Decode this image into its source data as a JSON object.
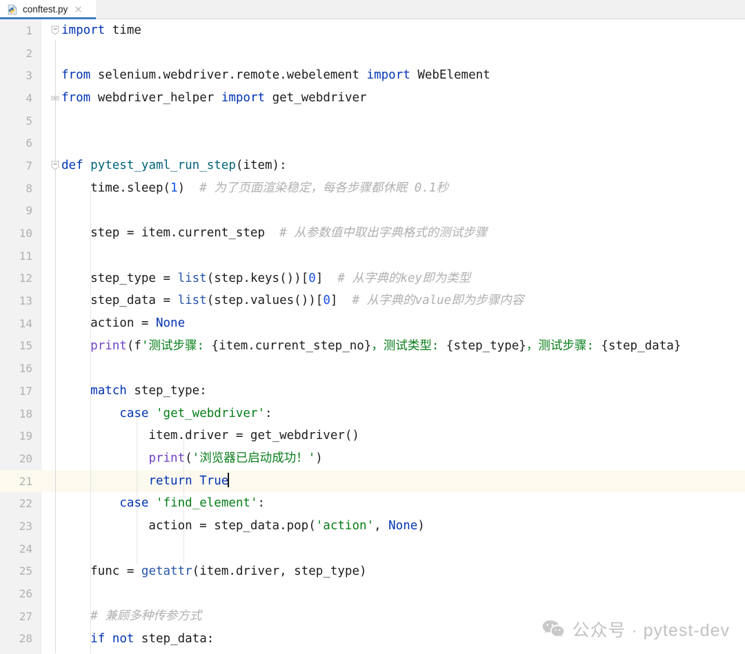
{
  "window": {
    "tab": {
      "label": "conftest.py",
      "icon": "python-file-icon",
      "close_icon": "close-icon",
      "active": true,
      "accent_color": "#3c7bc4"
    }
  },
  "editor": {
    "language": "python",
    "current_line": 21,
    "current_line_highlight": "#fcfaee",
    "gutter_bg": "#f2f2f2",
    "background": "#ffffff",
    "caret_line": 21,
    "colors": {
      "keyword": "#0033b3",
      "string": "#067d17",
      "number": "#1750eb",
      "comment": "#b0b0b0",
      "function": "#00627a",
      "builtin": "#6f42c1",
      "call": "#2555a8",
      "text": "#1c1c1c"
    },
    "lines": [
      {
        "no": 1,
        "fold": "collapse-minus-icon",
        "text": "import time"
      },
      {
        "no": 2,
        "fold": "",
        "text": ""
      },
      {
        "no": 3,
        "fold": "",
        "text": "from selenium.webdriver.remote.webelement import WebElement"
      },
      {
        "no": 4,
        "fold": "collapse-end-icon",
        "text": "from webdriver_helper import get_webdriver"
      },
      {
        "no": 5,
        "fold": "",
        "text": ""
      },
      {
        "no": 6,
        "fold": "",
        "text": ""
      },
      {
        "no": 7,
        "fold": "collapse-minus-icon",
        "text": "def pytest_yaml_run_step(item):"
      },
      {
        "no": 8,
        "fold": "",
        "text": "    time.sleep(1)  # 为了页面渲染稳定，每各步骤都休眠 0.1秒"
      },
      {
        "no": 9,
        "fold": "",
        "text": ""
      },
      {
        "no": 10,
        "fold": "",
        "text": "    step = item.current_step  # 从参数值中取出字典格式的测试步骤"
      },
      {
        "no": 11,
        "fold": "",
        "text": ""
      },
      {
        "no": 12,
        "fold": "",
        "text": "    step_type = list(step.keys())[0]  # 从字典的key即为类型"
      },
      {
        "no": 13,
        "fold": "",
        "text": "    step_data = list(step.values())[0]  # 从字典的value即为步骤内容"
      },
      {
        "no": 14,
        "fold": "",
        "text": "    action = None"
      },
      {
        "no": 15,
        "fold": "",
        "text": "    print(f'测试步骤: {item.current_step_no}，测试类型: {step_type}，测试步骤: {step_data}"
      },
      {
        "no": 16,
        "fold": "",
        "text": ""
      },
      {
        "no": 17,
        "fold": "",
        "text": "    match step_type:"
      },
      {
        "no": 18,
        "fold": "",
        "text": "        case 'get_webdriver':"
      },
      {
        "no": 19,
        "fold": "",
        "text": "            item.driver = get_webdriver()"
      },
      {
        "no": 20,
        "fold": "",
        "text": "            print('浏览器已启动成功！')"
      },
      {
        "no": 21,
        "fold": "",
        "text": "            return True"
      },
      {
        "no": 22,
        "fold": "",
        "text": "        case 'find_element':"
      },
      {
        "no": 23,
        "fold": "",
        "text": "            action = step_data.pop('action', None)"
      },
      {
        "no": 24,
        "fold": "",
        "text": ""
      },
      {
        "no": 25,
        "fold": "",
        "text": "    func = getattr(item.driver, step_type)"
      },
      {
        "no": 26,
        "fold": "",
        "text": ""
      },
      {
        "no": 27,
        "fold": "",
        "text": "    # 兼顾多种传参方式"
      },
      {
        "no": 28,
        "fold": "",
        "text": "    if not step_data:"
      }
    ]
  },
  "watermark": {
    "icon": "wechat-icon",
    "text": "公众号 · pytest-dev",
    "color": "#c2c2c2"
  }
}
